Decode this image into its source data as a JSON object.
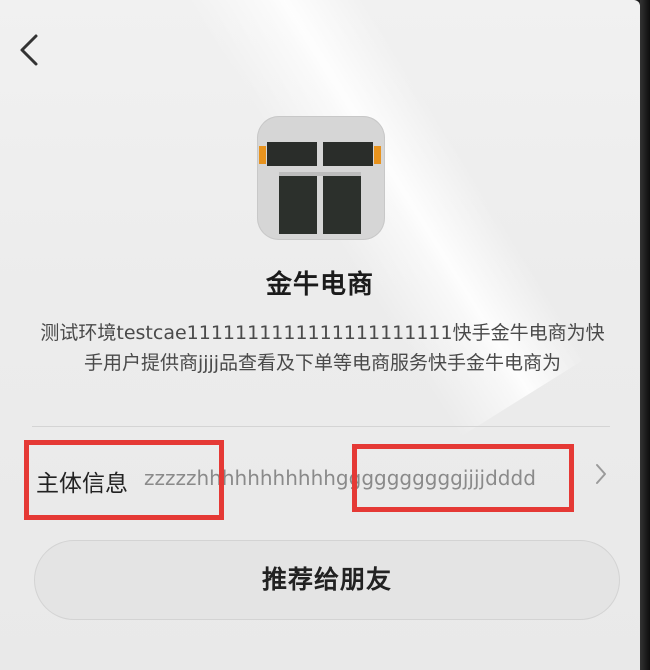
{
  "navigation": {
    "back_icon": "chevron-left-icon"
  },
  "app": {
    "icon": "store-front-icon",
    "name": "金牛电商",
    "description": "测试环境testcae1111111111111111111111快手金牛电商为快手用户提供商jjjj品查看及下单等电商服务快手金牛电商为"
  },
  "entity_info": {
    "label": "主体信息",
    "value": "zzzzzhhhhhhhhhhhggggggggggjjjjdddd",
    "chevron_icon": "chevron-right-icon"
  },
  "share_button": {
    "label": "推荐给朋友"
  },
  "colors": {
    "highlight": "#e53935",
    "background": "#ececec",
    "button_bg": "#e4e4e4",
    "secondary_text": "#8a8a8a"
  }
}
